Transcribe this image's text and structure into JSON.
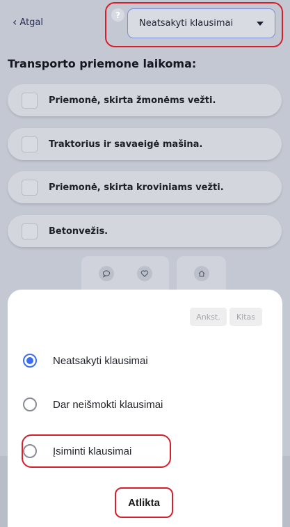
{
  "header": {
    "back_label": "Atgal",
    "help_symbol": "?",
    "filter_selected": "Neatsakyti klausimai"
  },
  "question": {
    "title": "Transporto priemone laikoma:",
    "options": [
      "Priemonė, skirta žmonėms vežti.",
      "Traktorius ir savaeigė mašina.",
      "Priemonė, skirta kroviniams vežti.",
      "Betonvežis."
    ]
  },
  "actions": {
    "icons": [
      "comment-icon",
      "heart-icon",
      "home-icon"
    ]
  },
  "sheet": {
    "prev_label": "Ankst.",
    "next_label": "Kitas",
    "choices": [
      {
        "label": "Neatsakyti klausimai",
        "selected": true
      },
      {
        "label": "Dar neišmokti klausimai",
        "selected": false
      },
      {
        "label": "Įsiminti klausimai",
        "selected": false
      }
    ],
    "done_label": "Atlikta"
  },
  "colors": {
    "accent": "#3b6df0",
    "highlight": "#d51f2a",
    "overlay": "#c4c8d3"
  }
}
